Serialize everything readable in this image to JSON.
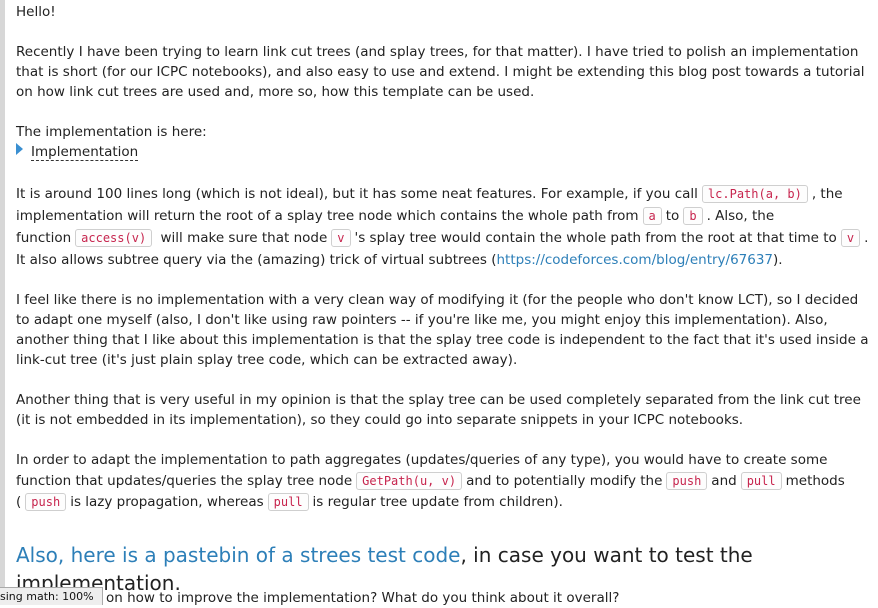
{
  "greeting": "Hello!",
  "p1": "Recently I have been trying to learn link cut trees (and splay trees, for that matter). I have tried to polish an implementation that is short (for our ICPC notebooks), and also easy to use and extend. I might be extending this blog post towards a tutorial on how link cut trees are used and, more so, how this template can be used.",
  "impl_intro": "The implementation is here:",
  "spoiler_label": "Implementation",
  "p3": {
    "t1": "It is around 100 lines long (which is not ideal), but it has some neat features. For example, if you call",
    "c1": "lc.Path(a, b)",
    "t2": ", the implementation will return the root of a splay tree node which contains the whole path from",
    "c2": "a",
    "t3": "to",
    "c3": "b",
    "t4": ". Also, the function",
    "c4": "access(v)",
    "t5": "will make sure that node",
    "c5": "v",
    "t6": "'s splay tree would contain the whole path from the root at that time to",
    "c6": "v",
    "t7": ". It also allows subtree query via the (amazing) trick of virtual subtrees (",
    "link": "https://codeforces.com/blog/entry/67637",
    "t8": ")."
  },
  "p4": "I feel like there is no implementation with a very clean way of modifying it (for the people who don't know LCT), so I decided to adapt one myself (also, I don't like using raw pointers -- if you're like me, you might enjoy this implementation). Also, another thing that I like about this implementation is that the splay tree code is independent to the fact that it's used inside a link-cut tree (it's just plain splay tree code, which can be extracted away).",
  "p5": "Another thing that is very useful in my opinion is that the splay tree can be used completely separated from the link cut tree (it is not embedded in its implementation), so they could go into separate snippets in your ICPC notebooks.",
  "p6": {
    "t1": "In order to adapt the implementation to path aggregates (updates/queries of any type), you would have to create some function that updates/queries the splay tree node",
    "c1": "GetPath(u, v)",
    "t2": "and to potentially modify the",
    "c2": "push",
    "t3": "and",
    "c3": "pull",
    "t4": "methods (",
    "c4": "push",
    "t5": "is lazy propagation, whereas",
    "c5": "pull",
    "t6": "is regular tree update from children)."
  },
  "big": {
    "link": "Also, here is a pastebin of a strees test code",
    "rest": ", in case you want to test the implementation."
  },
  "last_line": "on how to improve the implementation? What do you think about it overall?",
  "status": "sing math: 100%"
}
